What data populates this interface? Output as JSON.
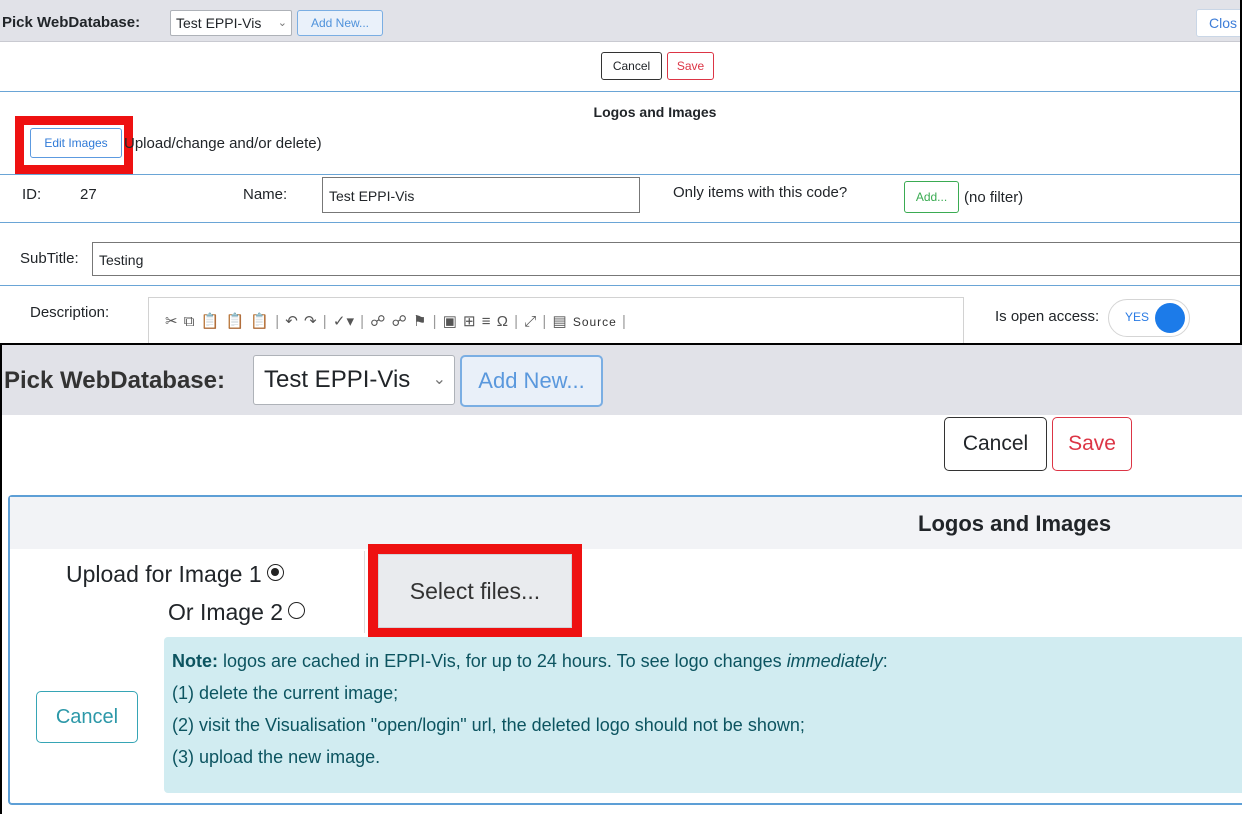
{
  "top": {
    "pick_label": "Pick WebDatabase:",
    "db_value": "Test EPPI-Vis",
    "add_new": "Add New...",
    "close": "Clos",
    "cancel": "Cancel",
    "save": "Save",
    "logos_title": "Logos and Images",
    "edit_images": "Edit Images",
    "edit_hint": "Upload/change and/or delete)",
    "id_label": "ID:",
    "id_value": "27",
    "name_label": "Name:",
    "name_value": "Test EPPI-Vis",
    "only_items_label": "Only items with this code?",
    "add_code": "Add...",
    "no_filter": "(no filter)",
    "subtitle_label": "SubTitle:",
    "subtitle_value": "Testing",
    "description_label": "Description:",
    "source_label": "Source",
    "open_access_label": "Is open access:",
    "open_access_value": "YES"
  },
  "bottom": {
    "pick_label": "Pick WebDatabase:",
    "db_value": "Test EPPI-Vis",
    "add_new": "Add New...",
    "cancel": "Cancel",
    "save": "Save",
    "logos_title": "Logos and Images",
    "upload_image1": "Upload for Image 1",
    "or_image2": "Or Image 2",
    "select_files": "Select files...",
    "cancel_upload": "Cancel",
    "note_bold": "Note:",
    "note_text": " logos are cached in EPPI-Vis, for up to 24 hours. To see logo changes ",
    "note_em": "immediately",
    "note_end": ":",
    "note_step1": "(1) delete the current image;",
    "note_step2": "(2) visit the Visualisation \"open/login\" url, the deleted logo should not be shown;",
    "note_step3": "(3) upload the new image."
  },
  "colors": {
    "highlight_red": "#ee1111",
    "primary_blue": "#1c7be9",
    "info_bg": "#d1ecf1",
    "danger": "#dc3545",
    "success": "#3aab52"
  }
}
